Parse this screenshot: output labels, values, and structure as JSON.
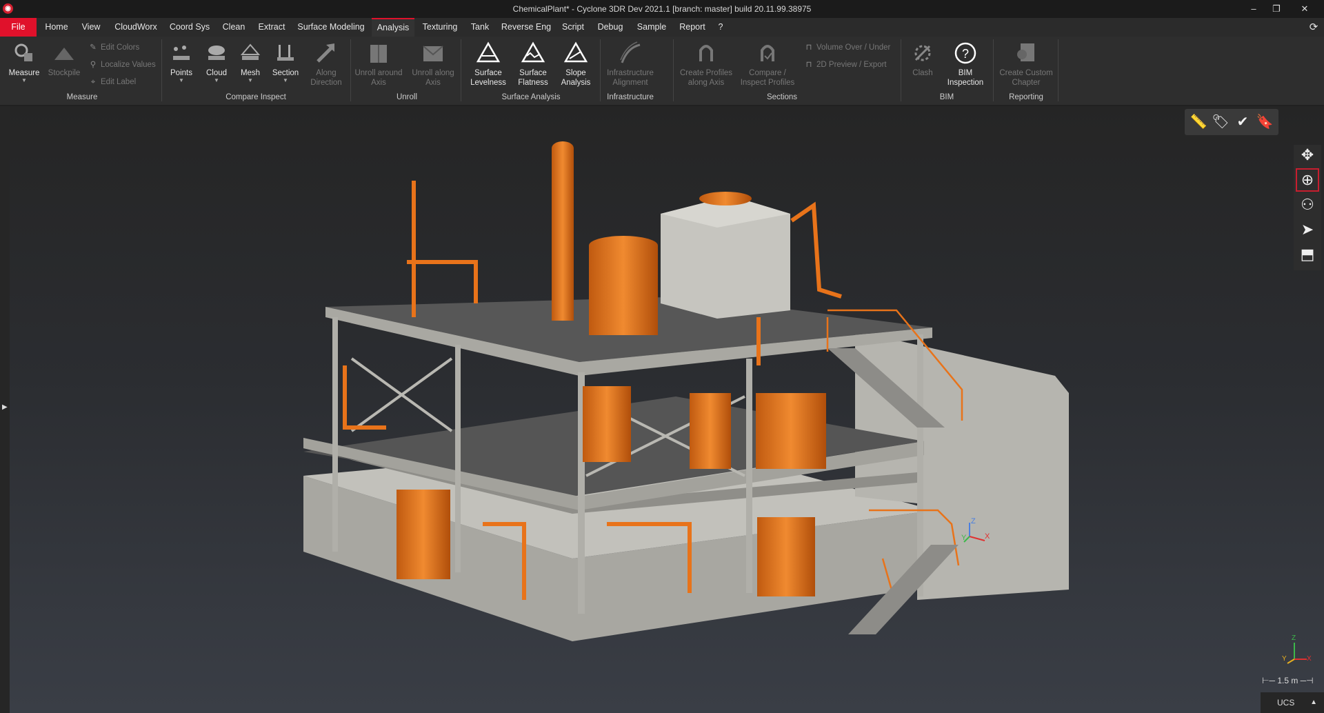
{
  "window": {
    "title": "ChemicalPlant* - Cyclone 3DR Dev 2021.1 [branch: master] build 20.11.99.38975",
    "app_icon": "cyclone-logo-icon",
    "minimize": "–",
    "restore": "❐",
    "close": "✕"
  },
  "menu": {
    "tabs": [
      "File",
      "Home",
      "View",
      "CloudWorx",
      "Coord Sys",
      "Clean",
      "Extract",
      "Surface Modeling",
      "Analysis",
      "Texturing",
      "Tank",
      "Reverse Eng",
      "Script",
      "Debug",
      "Sample",
      "Report",
      "?"
    ],
    "active_tab": "Analysis",
    "sync_icon": "sync-icon"
  },
  "ribbon": {
    "measure": {
      "measure": "Measure",
      "stockpile": "Stockpile",
      "edit_colors": "Edit Colors",
      "localize_values": "Localize Values",
      "edit_label": "Edit Label",
      "group": "Measure"
    },
    "compare": {
      "points": "Points",
      "cloud": "Cloud",
      "mesh": "Mesh",
      "section": "Section",
      "along_direction": "Along Direction",
      "group": "Compare Inspect"
    },
    "unroll": {
      "around_axis": "Unroll around Axis",
      "along_axis": "Unroll along Axis",
      "group": "Unroll"
    },
    "surface": {
      "levelness": "Surface Levelness",
      "flatness": "Surface Flatness",
      "slope": "Slope Analysis",
      "group": "Surface Analysis"
    },
    "infra": {
      "alignment": "Infrastructure Alignment",
      "group": "Infrastructure"
    },
    "sections": {
      "create_profiles": "Create Profiles along Axis",
      "compare_profiles": "Compare / Inspect Profiles",
      "volume": "Volume Over / Under",
      "preview": "2D Preview / Export",
      "group": "Sections"
    },
    "bim": {
      "clash": "Clash",
      "inspection": "BIM Inspection",
      "group": "BIM"
    },
    "reporting": {
      "chapter": "Create Custom Chapter",
      "group": "Reporting"
    }
  },
  "viewport": {
    "scale_label": "1.5 m",
    "ucs_label": "UCS",
    "axis_labels": {
      "z": "Z",
      "x": "X",
      "y": "Y"
    },
    "colors": {
      "equipment": "#e8731a",
      "structure": "#b9b8b2",
      "background": "#2b2d31",
      "accent": "#e0112b"
    }
  }
}
